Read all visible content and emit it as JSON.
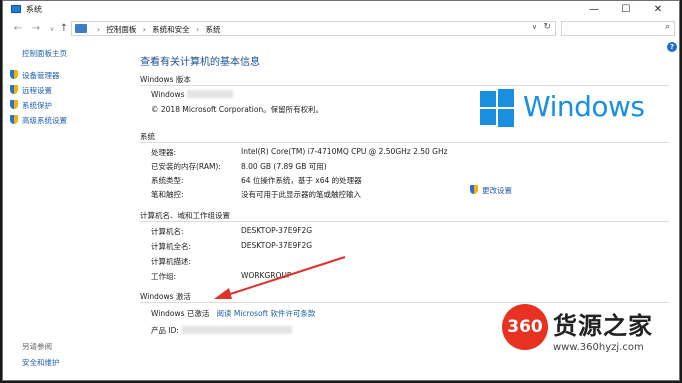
{
  "window": {
    "title": "系统",
    "btn_min": "—",
    "btn_max": "☐",
    "btn_close": "✕"
  },
  "address": {
    "crumbs": [
      "控制面板",
      "系统和安全",
      "系统"
    ],
    "separator": "›",
    "nav_back": "←",
    "nav_forward": "→",
    "nav_recent": "∨",
    "nav_up": "↑",
    "refresh": "↻",
    "dropdown": "∨",
    "search_icon": "⌕"
  },
  "help": "?",
  "left_pane": {
    "home": "控制面板主页",
    "links": [
      "设备管理器",
      "远程设置",
      "系统保护",
      "高级系统设置"
    ],
    "see_also_title": "另请参阅",
    "see_also_links": [
      "安全和维护"
    ]
  },
  "main": {
    "title": "查看有关计算机的基本信息",
    "edition": {
      "title": "Windows 版本",
      "name": "Windows",
      "copyright": "© 2018 Microsoft Corporation。保留所有权利。"
    },
    "logo_text": "Windows",
    "system": {
      "title": "系统",
      "rows": [
        {
          "label": "处理器:",
          "value": "Intel(R) Core(TM) i7-4710MQ CPU @ 2.50GHz   2.50 GHz"
        },
        {
          "label": "已安装的内存(RAM):",
          "value": "8.00 GB (7.89 GB 可用)"
        },
        {
          "label": "系统类型:",
          "value": "64 位操作系统，基于 x64 的处理器"
        },
        {
          "label": "笔和触控:",
          "value": "没有可用于此显示器的笔或触控输入"
        }
      ]
    },
    "computer": {
      "title": "计算机名、域和工作组设置",
      "change_settings": "更改设置",
      "rows": [
        {
          "label": "计算机名:",
          "value": "DESKTOP-37E9F2G"
        },
        {
          "label": "计算机全名:",
          "value": "DESKTOP-37E9F2G"
        },
        {
          "label": "计算机描述:",
          "value": ""
        },
        {
          "label": "工作组:",
          "value": "WORKGROUP"
        }
      ]
    },
    "activation": {
      "title": "Windows 激活",
      "status": "Windows 已激活",
      "license_link": "阅读 Microsoft 软件许可条款",
      "product_id_label": "产品 ID:"
    }
  },
  "watermark": {
    "badge": "360",
    "text": "货源之家",
    "url": "www.360hyzj.com"
  },
  "colors": {
    "accent": "#1c5fb0",
    "logo": "#1a8fe0",
    "arrow": "#e0302a",
    "watermark": "#e73222"
  }
}
